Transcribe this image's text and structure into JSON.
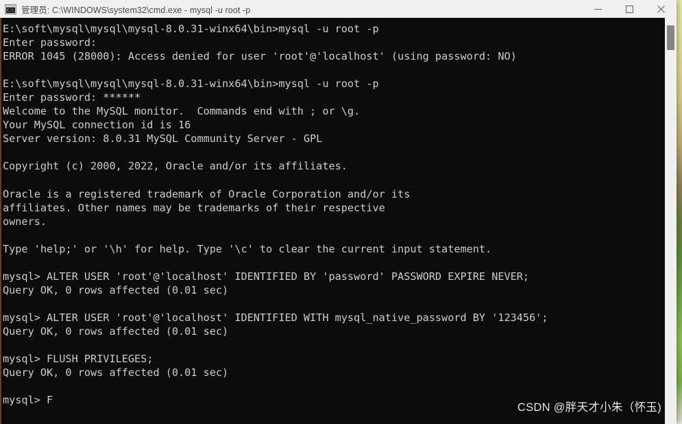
{
  "window": {
    "title": "管理员: C:\\WINDOWS\\system32\\cmd.exe - mysql  -u root -p",
    "icon_name": "cmd-console-icon",
    "icon_glyph": "C:\\",
    "minimize_label": "—",
    "maximize_label": "□",
    "close_label": "✕",
    "titlebar_bg": "#f0f0f0",
    "console_bg": "#0c0c0c",
    "console_fg": "#cccccc"
  },
  "console": {
    "prompt_path": "E:\\soft\\mysql\\mysql\\mysql-8.0.31-winx64\\bin>",
    "mysql_prompt": "mysql>",
    "lines": [
      "E:\\soft\\mysql\\mysql\\mysql-8.0.31-winx64\\bin>mysql -u root -p",
      "Enter password:",
      "ERROR 1045 (28000): Access denied for user 'root'@'localhost' (using password: NO)",
      "",
      "E:\\soft\\mysql\\mysql\\mysql-8.0.31-winx64\\bin>mysql -u root -p",
      "Enter password: ******",
      "Welcome to the MySQL monitor.  Commands end with ; or \\g.",
      "Your MySQL connection id is 16",
      "Server version: 8.0.31 MySQL Community Server - GPL",
      "",
      "Copyright (c) 2000, 2022, Oracle and/or its affiliates.",
      "",
      "Oracle is a registered trademark of Oracle Corporation and/or its",
      "affiliates. Other names may be trademarks of their respective",
      "owners.",
      "",
      "Type 'help;' or '\\h' for help. Type '\\c' to clear the current input statement.",
      "",
      "mysql> ALTER USER 'root'@'localhost' IDENTIFIED BY 'password' PASSWORD EXPIRE NEVER;",
      "Query OK, 0 rows affected (0.01 sec)",
      "",
      "mysql> ALTER USER 'root'@'localhost' IDENTIFIED WITH mysql_native_password BY '123456';",
      "Query OK, 0 rows affected (0.01 sec)",
      "",
      "mysql> FLUSH PRIVILEGES;",
      "Query OK, 0 rows affected (0.01 sec)",
      "",
      "mysql> F"
    ],
    "error_code": "ERROR 1045 (28000)",
    "connection_id": "16",
    "server_version": "8.0.31",
    "query_time": "0.01 sec",
    "rows_affected": "0"
  },
  "scrollbar": {
    "thumb_color": "#868686",
    "track_color": "#f0f0f0"
  },
  "watermark": {
    "text": "CSDN @胖天才小朱（怀玉)"
  }
}
